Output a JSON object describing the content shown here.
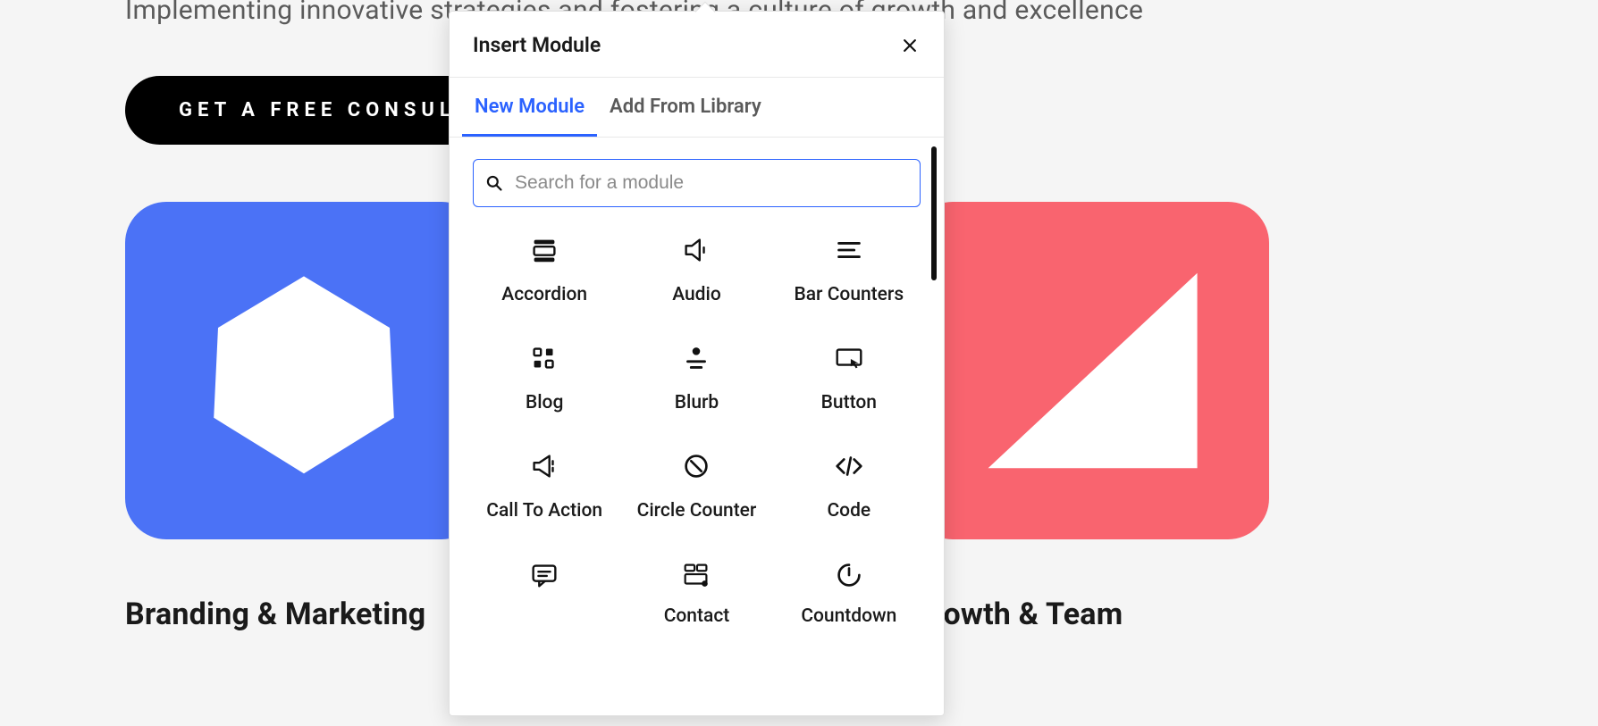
{
  "background": {
    "subtitle": "Implementing innovative strategies and fostering a culture of growth and excellence",
    "cta_label": "GET A FREE CONSULTATION",
    "cards": [
      {
        "title": "Branding & Marketing"
      },
      {
        "title": "Growth & Team"
      }
    ]
  },
  "modal": {
    "title": "Insert Module",
    "tabs": {
      "new_module": "New Module",
      "add_from_library": "Add From Library"
    },
    "search": {
      "placeholder": "Search for a module"
    },
    "modules": {
      "accordion": "Accordion",
      "audio": "Audio",
      "bar_counters": "Bar Counters",
      "blog": "Blog",
      "blurb": "Blurb",
      "button": "Button",
      "call_to_action": "Call To Action",
      "circle_counter": "Circle Counter",
      "code": "Code",
      "comments": "Comments",
      "contact": "Contact",
      "countdown": "Countdown"
    }
  }
}
